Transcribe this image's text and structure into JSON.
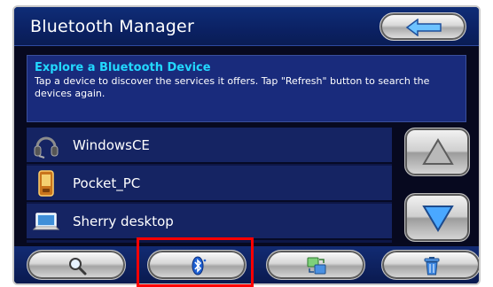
{
  "window": {
    "title": "Bluetooth Manager"
  },
  "header": {
    "back_icon": "back-arrow-icon"
  },
  "info": {
    "heading": "Explore a Bluetooth Device",
    "text": "Tap a device to discover the services it offers. Tap \"Refresh\" button to search the devices again."
  },
  "devices": [
    {
      "label": "WindowsCE",
      "icon": "headset-icon"
    },
    {
      "label": "Pocket_PC",
      "icon": "pda-icon"
    },
    {
      "label": "Sherry desktop",
      "icon": "laptop-icon"
    }
  ],
  "scroll": {
    "up_icon": "triangle-up-icon",
    "down_icon": "triangle-down-icon"
  },
  "toolbar": [
    {
      "icon": "magnifier-icon"
    },
    {
      "icon": "bluetooth-icon"
    },
    {
      "icon": "sync-icon"
    },
    {
      "icon": "trash-icon"
    }
  ],
  "colors": {
    "title_bar": "#0b2163",
    "info_box": "#192b7c",
    "info_heading": "#22d8ff",
    "list_row": "#152463",
    "highlight": "#ff0000"
  }
}
